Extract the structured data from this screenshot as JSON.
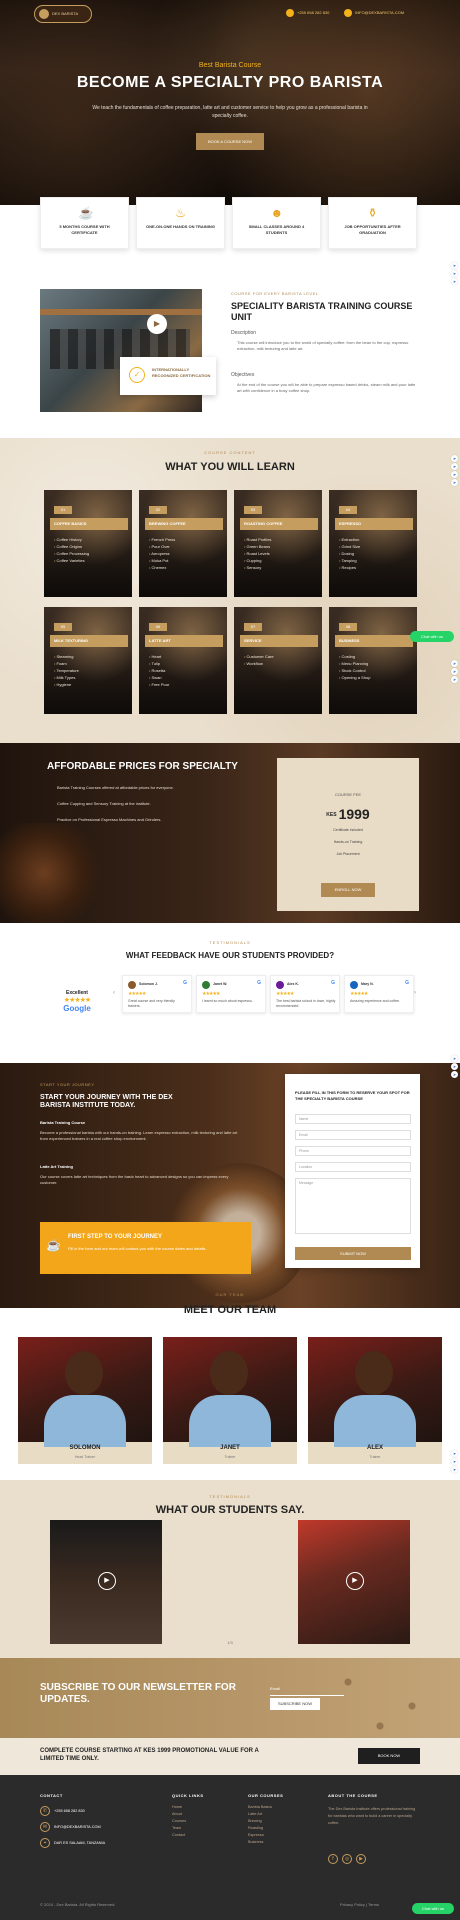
{
  "header": {
    "logo_text": "DEX BARISTA",
    "phone": "+255 658 282 830",
    "email": "INFO@DEXBARISTA.COM"
  },
  "hero": {
    "kicker": "Best Barista Course",
    "title": "BECOME A SPECIALTY PRO BARISTA",
    "description": "We teach the fundamentals of coffee preparation, latte art and customer service to help you grow as a professional barista in specialty coffee.",
    "cta": "BOOK A COURSE NOW"
  },
  "features": [
    {
      "icon": "cup-icon",
      "label": "5 MONTHS COURSE WITH CERTIFICATE"
    },
    {
      "icon": "latte-icon",
      "label": "ONE-ON-ONE HANDS ON TRAINING"
    },
    {
      "icon": "group-icon",
      "label": "SMALL CLASSES AROUND 4 STUDENTS"
    },
    {
      "icon": "pot-icon",
      "label": "JOB OPPORTUNITIES AFTER GRADUATION"
    }
  ],
  "unit": {
    "kicker": "COURSE FOR EVERY BARISTA LEVEL",
    "title": "SPECIALITY BARISTA TRAINING COURSE UNIT",
    "cert_text": "INTERNATIONALLY RECOGNIZED CERTIFICATION",
    "label1": "Description",
    "desc1": "This course will introduce you to the world of specialty coffee: from the bean to the cup, espresso extraction, milk texturing and latte art.",
    "label2": "Objectives",
    "desc2": "At the end of the course you will be able to prepare espresso based drinks, steam milk and pour latte art with confidence in a busy coffee shop."
  },
  "learn": {
    "kicker": "COURSE CONTENT",
    "title": "WHAT YOU WILL LEARN",
    "cards": [
      {
        "num": "01",
        "title": "COFFEE BASICS",
        "items": [
          "Coffee History",
          "Coffee Origins",
          "Coffee Processing",
          "Coffee Varieties"
        ]
      },
      {
        "num": "02",
        "title": "BREWING COFFEE",
        "items": [
          "French Press",
          "Pour Over",
          "Aeropress",
          "Moka Pot",
          "Chemex"
        ]
      },
      {
        "num": "03",
        "title": "ROASTING COFFEE",
        "items": [
          "Roast Profiles",
          "Green Beans",
          "Roast Levels",
          "Cupping",
          "Sensory"
        ]
      },
      {
        "num": "04",
        "title": "ESPRESSO",
        "items": [
          "Extraction",
          "Grind Size",
          "Dosing",
          "Tamping",
          "Recipes"
        ]
      },
      {
        "num": "05",
        "title": "MILK TEXTURING",
        "items": [
          "Steaming",
          "Foam",
          "Temperature",
          "Milk Types",
          "Hygiene"
        ]
      },
      {
        "num": "06",
        "title": "LATTE ART",
        "items": [
          "Heart",
          "Tulip",
          "Rosetta",
          "Swan",
          "Free Pour"
        ]
      },
      {
        "num": "07",
        "title": "SERVICE",
        "items": [
          "Customer Care",
          "Workflow"
        ]
      },
      {
        "num": "08",
        "title": "BUSINESS",
        "items": [
          "Costing",
          "Menu Planning",
          "Stock Control",
          "Opening a Shop"
        ]
      }
    ]
  },
  "prices": {
    "title": "AFFORDABLE PRICES FOR SPECIALTY",
    "points": [
      "Barista Training Courses offered at affordable prices for everyone.",
      "Coffee Cupping and Sensory Training at the institute.",
      "Practice on Professional Espresso Machines and Grinders."
    ],
    "card": {
      "label": "COURSE FEE",
      "currency": "KES",
      "amount": "1999",
      "f1": "Certificate included",
      "f2": "Hands-on Training",
      "f3": "Job Placement",
      "cta": "ENROLL NOW"
    }
  },
  "feedback": {
    "kicker": "TESTIMONIALS",
    "title": "WHAT FEEDBACK HAVE OUR STUDENTS PROVIDED?",
    "badge_title": "Excellent",
    "badge_brand": "Google",
    "reviews": [
      {
        "name": "Solomon J.",
        "text": "Great course and very friendly trainers."
      },
      {
        "name": "Janet W.",
        "text": "I learnt so much about espresso."
      },
      {
        "name": "Alex K.",
        "text": "The best barista school in town, highly recommended."
      },
      {
        "name": "Mary N.",
        "text": "Amazing experience and coffee."
      }
    ]
  },
  "journey": {
    "kicker": "START YOUR JOURNEY",
    "title": "START YOUR JOURNEY WITH THE DEX BARISTA INSTITUTE TODAY.",
    "p1": "Barista Training Course",
    "p2": "Become a professional barista with our hands-on training. Learn espresso extraction, milk texturing and latte art from experienced trainers in a real coffee shop environment.",
    "p3": "Latte Art Training",
    "p4": "Our course covers latte art techniques from the basic heart to advanced designs so you can impress every customer.",
    "box_title": "FIRST STEP TO YOUR JOURNEY",
    "box_text": "Fill in the form and our team will contact you with the course dates and details.",
    "form_title": "PLEASE FILL IN THIS FORM TO RESERVE YOUR SPOT FOR THE SPECIALTY BARISTA COURSE",
    "fields": [
      "Name",
      "Email",
      "Phone",
      "Location",
      "Message"
    ],
    "submit": "SUBMIT NOW"
  },
  "team": {
    "kicker": "OUR TEAM",
    "title": "MEET OUR TEAM",
    "members": [
      {
        "name": "SOLOMON",
        "role": "Head Trainer"
      },
      {
        "name": "JANET",
        "role": "Trainer"
      },
      {
        "name": "ALEX",
        "role": "Trainer"
      }
    ]
  },
  "students": {
    "kicker": "TESTIMONIALS",
    "title": "WHAT OUR STUDENTS SAY.",
    "pager": "1/3"
  },
  "newsletter": {
    "title": "SUBSCRIBE TO OUR NEWSLETTER FOR UPDATES.",
    "placeholder": "Email",
    "button": "SUBSCRIBE NOW"
  },
  "promo": {
    "text": "COMPLETE COURSE STARTING AT KES 1999 PROMOTIONAL VALUE FOR A LIMITED TIME ONLY.",
    "button": "BOOK NOW"
  },
  "footer": {
    "contact_phone": "+255 658 282 830",
    "contact_email": "INFO@DEXBARISTA.COM",
    "address": "DAR ES SALAAM, TANZANIA",
    "col1_title": "QUICK LINKS",
    "col1": [
      "Home",
      "About",
      "Courses",
      "Team",
      "Contact"
    ],
    "col2_title": "OUR COURSES",
    "col2": [
      "Barista Basics",
      "Latte Art",
      "Brewing",
      "Roasting",
      "Espresso",
      "Business"
    ],
    "col3_title": "ABOUT THE COURSE",
    "col3_text": "The Dex Barista Institute offers professional training for baristas who want to build a career in specialty coffee.",
    "copyright": "© 2024 - Dex Barista. All Rights Reserved.",
    "legal": "Privacy Policy | Terms",
    "whatsapp": "Chat with us"
  }
}
